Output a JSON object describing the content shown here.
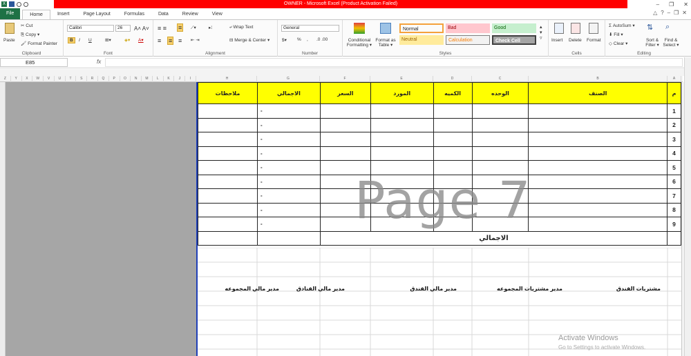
{
  "window": {
    "title": "OWNER  -  Microsoft Excel (Product Activation Failed)"
  },
  "tabs": [
    "File",
    "Home",
    "Insert",
    "Page Layout",
    "Formulas",
    "Data",
    "Review",
    "View"
  ],
  "ribbon": {
    "clipboard": {
      "label": "Clipboard",
      "paste": "Paste",
      "cut": "Cut",
      "copy": "Copy ▾",
      "format_painter": "Format Painter"
    },
    "font": {
      "label": "Font",
      "name": "Calibri",
      "size": "26",
      "bold": "B",
      "italic": "I",
      "underline": "U"
    },
    "alignment": {
      "label": "Alignment",
      "wrap": "Wrap Text",
      "merge": "Merge & Center ▾"
    },
    "number": {
      "label": "Number",
      "format": "General",
      "percent": "%"
    },
    "styles": {
      "label": "Styles",
      "conditional": "Conditional Formatting ▾",
      "format_table": "Format as Table ▾",
      "normal": "Normal",
      "bad": "Bad",
      "good": "Good",
      "neutral": "Neutral",
      "calculation": "Calculation",
      "check_cell": "Check Cell",
      "colors": {
        "normal_bg": "#ffffff",
        "bad_bg": "#ffc7ce",
        "good_bg": "#c6efce",
        "neutral_bg": "#ffeb9c",
        "calc_bg": "#f2f2f2",
        "check_bg": "#a5a5a5"
      }
    },
    "cells": {
      "label": "Cells",
      "insert": "Insert",
      "delete": "Delete",
      "format": "Format"
    },
    "editing": {
      "label": "Editing",
      "autosum": "AutoSum ▾",
      "fill": "Fill ▾",
      "clear": "Clear ▾",
      "sort": "Sort & Filter ▾",
      "find": "Find & Select ▾"
    }
  },
  "formula_bar": {
    "name_box": "E85",
    "fx": "fx",
    "value": ""
  },
  "columns": [
    "Z",
    "Y",
    "X",
    "W",
    "V",
    "U",
    "T",
    "S",
    "R",
    "Q",
    "P",
    "O",
    "N",
    "M",
    "L",
    "K",
    "J",
    "I",
    "H",
    "G",
    "F",
    "E",
    "D",
    "C",
    "B",
    "A"
  ],
  "rows": [
    "141",
    "142",
    "143",
    "144",
    "145",
    "146",
    "147",
    "148",
    "149",
    "150",
    "151",
    "152",
    "153",
    "154",
    "155",
    "156",
    "157",
    "158"
  ],
  "table": {
    "headers": [
      "م",
      "الصنف",
      "الوحده",
      "الكميه",
      "المورد",
      "السعر",
      "الاجمالي",
      "ملاحظات"
    ],
    "row_numbers": [
      "1",
      "2",
      "3",
      "4",
      "5",
      "6",
      "7",
      "8",
      "9"
    ],
    "dash": "-",
    "total_label": "الاجمالي"
  },
  "signatures": [
    "مشتريات الفندق",
    "مدير مشتريات المجموعه",
    "مدير مالي الفندق",
    "مدير مالي الفنادق",
    "مدير مالي المجموعه"
  ],
  "watermark": "Page 7",
  "activation": {
    "line1": "Activate Windows",
    "line2": "Go to Settings to activate Windows."
  },
  "accent": {
    "excel_green": "#1e7145",
    "title_red": "#ff0000",
    "header_yellow": "#ffff00",
    "page_break_blue": "#1f3fb8"
  }
}
